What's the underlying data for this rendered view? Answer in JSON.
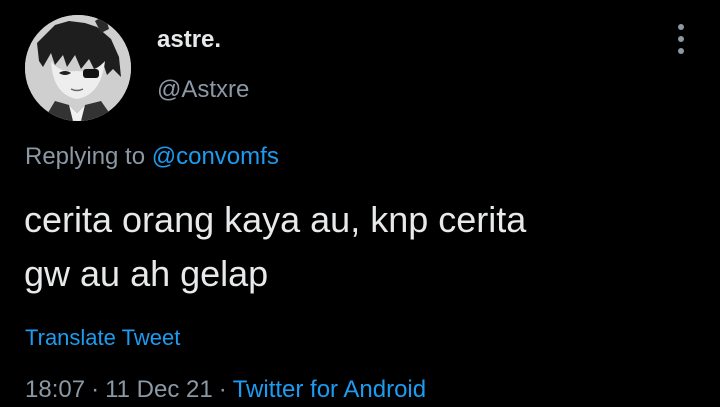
{
  "tweet": {
    "author": {
      "display_name": "astre.",
      "handle": "@Astxre",
      "avatar_icon": "anime-avatar-icon"
    },
    "more_icon": "vertical-ellipsis-icon",
    "reply": {
      "prefix": "Replying to",
      "mention": "@convomfs"
    },
    "text_lines": [
      "cerita orang kaya au, knp cerita",
      "gw au ah gelap"
    ],
    "translate_label": "Translate Tweet",
    "meta": {
      "time": "18:07",
      "separator": "·",
      "date": "11 Dec 21",
      "source": "Twitter for Android"
    }
  },
  "colors": {
    "background": "#000000",
    "primary_text": "#e7e9ea",
    "secondary_text": "#8b98a5",
    "accent": "#1d9bf0"
  }
}
